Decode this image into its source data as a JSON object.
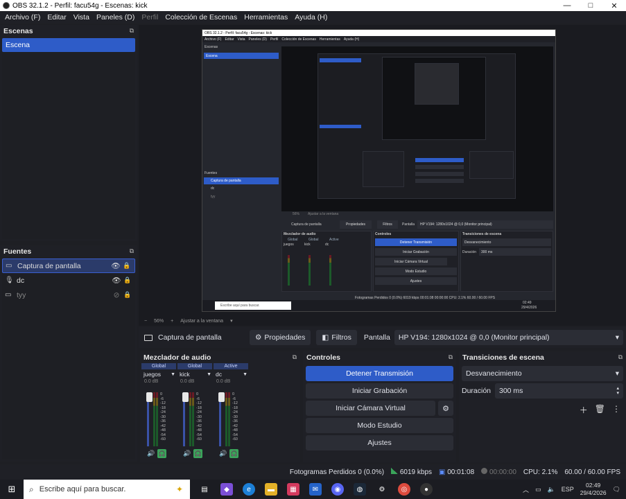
{
  "window": {
    "title": "OBS 32.1.2 - Perfil: facu54g - Escenas: kick",
    "min": "—",
    "max": "□",
    "close": "✕"
  },
  "menu": [
    "Archivo (F)",
    "Editar",
    "Vista",
    "Paneles (D)",
    "Perfil",
    "Colección de Escenas",
    "Herramientas",
    "Ayuda (H)"
  ],
  "scenes": {
    "title": "Escenas",
    "items": [
      "Escena"
    ]
  },
  "sources": {
    "title": "Fuentes",
    "items": [
      {
        "label": "Captura de pantalla",
        "icon": "monitor-icon",
        "visible": true
      },
      {
        "label": "dc",
        "icon": "microphone-icon",
        "visible": true
      },
      {
        "label": "tyy",
        "icon": "monitor-icon",
        "visible": false
      }
    ]
  },
  "zoom": {
    "value": "56%",
    "fit_label": "Ajustar a la ventana"
  },
  "source_toolbar": {
    "name": "Captura de pantalla",
    "properties": "Propiedades",
    "filters": "Filtros",
    "display_label": "Pantalla",
    "display_value": "HP V194: 1280x1024 @ 0,0 (Monitor principal)"
  },
  "mixer": {
    "title": "Mezclador de audio",
    "channels": [
      {
        "tag": "Global",
        "name": "juegos",
        "db": "0.0 dB"
      },
      {
        "tag": "Global",
        "name": "kick",
        "db": "0.0 dB"
      },
      {
        "tag": "Active",
        "name": "dc",
        "db": "0.0 dB"
      }
    ],
    "scale": [
      "0",
      "-6",
      "-12",
      "-18",
      "-24",
      "-30",
      "-36",
      "-42",
      "-48",
      "-54",
      "-60"
    ]
  },
  "controls": {
    "title": "Controles",
    "stop_stream": "Detener Transmisión",
    "start_record": "Iniciar Grabación",
    "virtual_cam": "Iniciar Cámara Virtual",
    "studio": "Modo Estudio",
    "settings": "Ajustes"
  },
  "transitions": {
    "title": "Transiciones de escena",
    "selected": "Desvanecimiento",
    "duration_label": "Duración",
    "duration_value": "300 ms"
  },
  "status": {
    "dropped": "Fotogramas Perdidos 0 (0.0%)",
    "bitrate": "6019 kbps",
    "stream_time": "00:01:08",
    "record_time": "00:00:00",
    "cpu": "CPU: 2.1%",
    "fps": "60.00 / 60.00 FPS"
  },
  "taskbar": {
    "search_placeholder": "Escribe aquí para buscar.",
    "lang": "ESP",
    "time": "02:49",
    "date": "29/4/2026"
  },
  "nested": {
    "title": "OBS 32.1.2 - Perfil: facu54g - Escenas: kick",
    "menu": [
      "Archivo (F)",
      "Editar",
      "Vista",
      "Paneles (D)",
      "Perfil",
      "Colección de Escenas",
      "Herramientas",
      "Ayuda (H)"
    ],
    "scenes_title": "Escenas",
    "scene": "Escena",
    "sources_title": "Fuentes",
    "src1": "Captura de pantalla",
    "src2": "dc",
    "src3": "tyy",
    "zoom": "56%",
    "fit": "Ajustar a la ventana",
    "props": "Propiedades",
    "filters": "Filtros",
    "display_label": "Pantalla",
    "display_value": "HP V194: 1280x1024 @ 0,0 (Monitor principal)",
    "mixer_title": "Mezclador de audio",
    "controls_title": "Controles",
    "trans_title": "Transiciones de escena",
    "stop": "Detener Transmisión",
    "rec": "Iniciar Grabación",
    "vcam": "Iniciar Cámara Virtual",
    "studio": "Modo Estudio",
    "settings": "Ajustes",
    "trans_sel": "Desvanecimiento",
    "dur_label": "Duración",
    "dur_val": "300 ms",
    "status": "Fotogramas Perdidos 0 (0.0%)   6019 kbps   00:01:08   00:00:00   CPU: 2.1%   60.00 / 60.00 FPS",
    "search": "Escribe aquí para buscar.",
    "ch_tags": [
      "Global",
      "Global",
      "Active"
    ],
    "ch_names": [
      "juegos",
      "kick",
      "dc"
    ],
    "time": "02:49",
    "date": "29/4/2026"
  }
}
